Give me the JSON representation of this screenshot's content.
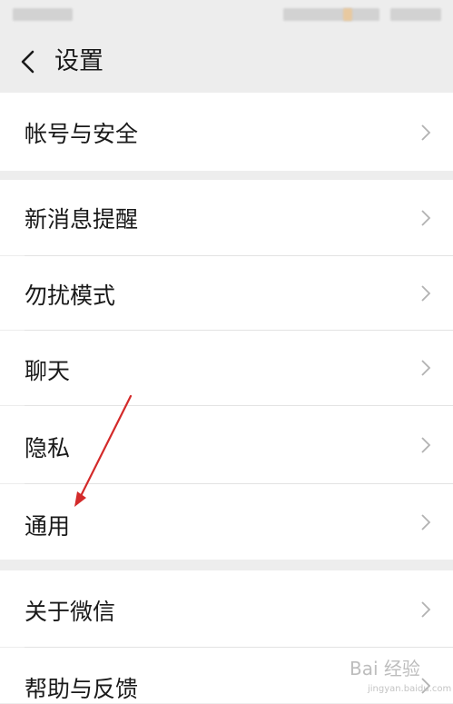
{
  "header": {
    "title": "设置",
    "back_icon": "chevron-left-icon"
  },
  "groups": [
    {
      "items": [
        {
          "label": "帐号与安全"
        }
      ]
    },
    {
      "items": [
        {
          "label": "新消息提醒"
        },
        {
          "label": "勿扰模式"
        },
        {
          "label": "聊天"
        },
        {
          "label": "隐私"
        },
        {
          "label": "通用"
        }
      ]
    },
    {
      "items": [
        {
          "label": "关于微信"
        },
        {
          "label": "帮助与反馈"
        }
      ]
    }
  ],
  "annotation": {
    "icon": "red-arrow-icon",
    "color": "#d32a2a"
  },
  "watermark": {
    "text": "Bai 经验",
    "sub": "jingyan.baidu.com"
  },
  "colors": {
    "background": "#ededed",
    "row": "#ffffff",
    "chevron": "#b2b2b2"
  }
}
